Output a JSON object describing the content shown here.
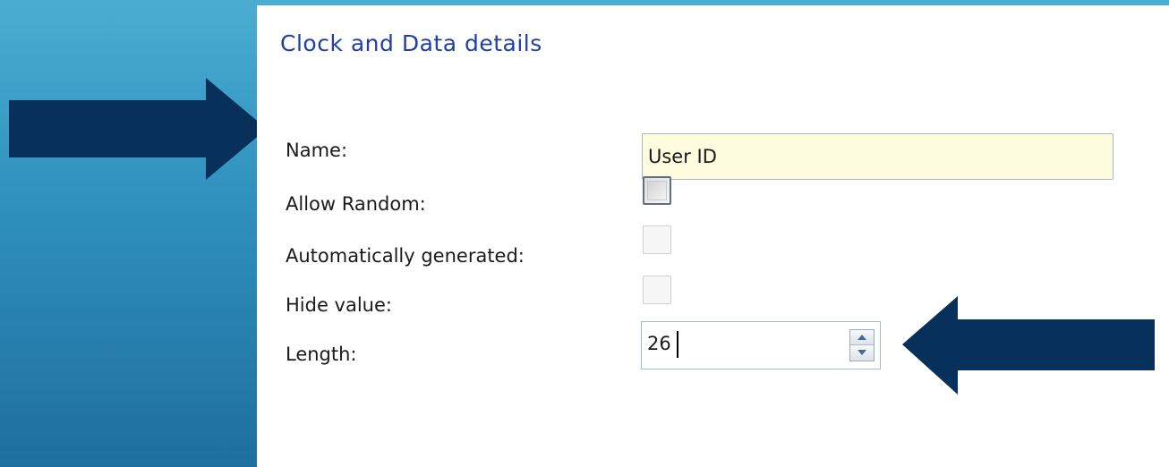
{
  "panel": {
    "title": "Clock and Data details"
  },
  "fields": {
    "name_label": "Name:",
    "name_value": "User ID",
    "allow_random_label": "Allow Random:",
    "allow_random_checked": false,
    "allow_random_enabled": true,
    "auto_generated_label": "Automatically generated:",
    "auto_generated_checked": false,
    "auto_generated_enabled": false,
    "hide_value_label": "Hide value:",
    "hide_value_checked": false,
    "hide_value_enabled": false,
    "length_label": "Length:",
    "length_value": "26"
  },
  "annotations": {
    "arrow_color": "#07305a",
    "arrows": [
      {
        "points_to": "name-field",
        "direction": "right"
      },
      {
        "points_to": "length-field",
        "direction": "left"
      }
    ]
  },
  "colors": {
    "title": "#1f3fa6",
    "name_input_background": "#fefcde",
    "background_gradient_top": "#4aadd0",
    "background_gradient_bottom": "#1e6f9e"
  }
}
